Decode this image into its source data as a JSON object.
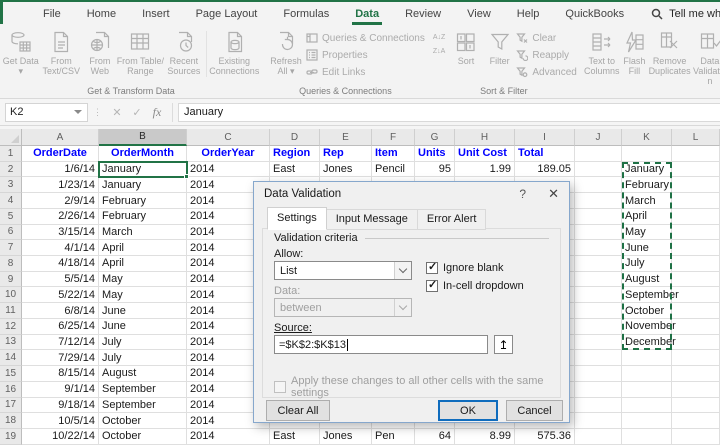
{
  "colors": {
    "accent_green": "#217346",
    "header_blue": "#0000ff",
    "ok_border_blue": "#0f6cbd",
    "ants_green": "#1e7145"
  },
  "tabs": [
    "File",
    "Home",
    "Insert",
    "Page Layout",
    "Formulas",
    "Data",
    "Review",
    "View",
    "Help",
    "QuickBooks"
  ],
  "search": {
    "label": "Tell me what you want to do"
  },
  "ribbon": {
    "g1": {
      "label": "Get & Transform Data",
      "b1": "Get Data ▾",
      "b2": "From Text/CSV",
      "b3": "From Web",
      "b4": "From Table/ Range",
      "b5": "Recent Sources",
      "b6": "Existing Connections"
    },
    "g2": {
      "label": "Queries & Connections",
      "b1": "Refresh All ▾",
      "b2": "Queries & Connections",
      "b3": "Properties",
      "b4": "Edit Links"
    },
    "g3": {
      "label": "Sort & Filter",
      "asc_icon": "A↓Z",
      "desc_icon": "Z↓A",
      "b1": "Sort",
      "b2": "Filter",
      "b3": "Clear",
      "b4": "Reapply",
      "b5": "Advanced"
    },
    "g4": {
      "b1": "Text to Columns",
      "b2": "Flash Fill",
      "b3": "Remove Duplicates",
      "b4": "Data Validation"
    }
  },
  "formula": {
    "name_box": "K2",
    "cancel_icon": "✕",
    "enter_icon": "✓",
    "fx_icon": "fx",
    "value": "January"
  },
  "sheet": {
    "col_letters": [
      "A",
      "B",
      "C",
      "D",
      "E",
      "F",
      "G",
      "H",
      "I",
      "J",
      "K",
      "L"
    ],
    "selected_column": "B",
    "header_row": [
      "OrderDate",
      "OrderMonth",
      "OrderYear",
      "Region",
      "Rep",
      "Item",
      "Units",
      "Unit Cost",
      "Total"
    ],
    "rows": [
      [
        "1/6/14",
        "January",
        "2014",
        "East",
        "Jones",
        "Pencil",
        "95",
        "1.99",
        "189.05"
      ],
      [
        "1/23/14",
        "January",
        "2014",
        "",
        "",
        "",
        "",
        "",
        ""
      ],
      [
        "2/9/14",
        "February",
        "2014",
        "",
        "",
        "",
        "",
        "",
        ""
      ],
      [
        "2/26/14",
        "February",
        "2014",
        "",
        "",
        "",
        "",
        "",
        ""
      ],
      [
        "3/15/14",
        "March",
        "2014",
        "",
        "",
        "",
        "",
        "",
        ""
      ],
      [
        "4/1/14",
        "April",
        "2014",
        "",
        "",
        "",
        "",
        "",
        ""
      ],
      [
        "4/18/14",
        "April",
        "2014",
        "",
        "",
        "",
        "",
        "",
        ""
      ],
      [
        "5/5/14",
        "May",
        "2014",
        "",
        "",
        "",
        "",
        "",
        ""
      ],
      [
        "5/22/14",
        "May",
        "2014",
        "",
        "",
        "",
        "",
        "",
        ""
      ],
      [
        "6/8/14",
        "June",
        "2014",
        "",
        "",
        "",
        "",
        "",
        ""
      ],
      [
        "6/25/14",
        "June",
        "2014",
        "",
        "",
        "",
        "",
        "",
        ""
      ],
      [
        "7/12/14",
        "July",
        "2014",
        "",
        "",
        "",
        "",
        "",
        ""
      ],
      [
        "7/29/14",
        "July",
        "2014",
        "",
        "",
        "",
        "",
        "",
        ""
      ],
      [
        "8/15/14",
        "August",
        "2014",
        "",
        "",
        "",
        "",
        "",
        ""
      ],
      [
        "9/1/14",
        "September",
        "2014",
        "",
        "",
        "",
        "",
        "",
        ""
      ],
      [
        "9/18/14",
        "September",
        "2014",
        "",
        "",
        "",
        "",
        "",
        ""
      ],
      [
        "10/5/14",
        "October",
        "2014",
        "",
        "",
        "",
        "",
        "",
        ""
      ],
      [
        "10/22/14",
        "October",
        "2014",
        "East",
        "Jones",
        "Pen",
        "64",
        "8.99",
        "575.36"
      ]
    ],
    "k_values": [
      "January",
      "February",
      "March",
      "April",
      "May",
      "June",
      "July",
      "August",
      "September",
      "October",
      "November",
      "December"
    ]
  },
  "dialog": {
    "title": "Data Validation",
    "help_icon": "?",
    "close_icon": "✕",
    "tab_settings": "Settings",
    "tab_input_message": "Input Message",
    "tab_error_alert": "Error Alert",
    "group_label": "Validation criteria",
    "allow_label": "Allow:",
    "allow_value": "List",
    "ignore_blank_label": "Ignore blank",
    "incell_dropdown_label": "In-cell dropdown",
    "data_label": "Data:",
    "data_value": "between",
    "source_label": "Source:",
    "source_value": "=$K$2:$K$13",
    "collapse_icon": "↥",
    "apply_label": "Apply these changes to all other cells with the same settings",
    "clear_all_label": "Clear All",
    "ok_label": "OK",
    "cancel_label": "Cancel"
  }
}
